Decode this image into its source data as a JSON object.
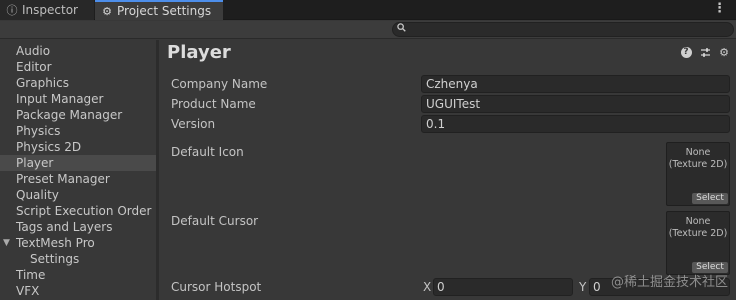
{
  "tabs": {
    "inspector_label": "Inspector",
    "project_settings_label": "Project Settings"
  },
  "menu_icon": "⋮",
  "search": {
    "placeholder": "",
    "value": ""
  },
  "sidebar": {
    "items": [
      {
        "label": "Audio"
      },
      {
        "label": "Editor"
      },
      {
        "label": "Graphics"
      },
      {
        "label": "Input Manager"
      },
      {
        "label": "Package Manager"
      },
      {
        "label": "Physics"
      },
      {
        "label": "Physics 2D"
      },
      {
        "label": "Player",
        "selected": true
      },
      {
        "label": "Preset Manager"
      },
      {
        "label": "Quality"
      },
      {
        "label": "Script Execution Order"
      },
      {
        "label": "Tags and Layers"
      },
      {
        "label": "TextMesh Pro",
        "expanded": true
      },
      {
        "label": "Settings",
        "child": true
      },
      {
        "label": "Time"
      },
      {
        "label": "VFX"
      }
    ]
  },
  "main": {
    "title": "Player",
    "company_name_label": "Company Name",
    "company_name_value": "Czhenya",
    "product_name_label": "Product Name",
    "product_name_value": "UGUITest",
    "version_label": "Version",
    "version_value": "0.1",
    "default_icon_label": "Default Icon",
    "default_cursor_label": "Default Cursor",
    "texture_none": "None",
    "texture_type": "(Texture 2D)",
    "select_label": "Select",
    "cursor_hotspot_label": "Cursor Hotspot",
    "hotspot_x_label": "X",
    "hotspot_x_value": "0",
    "hotspot_y_label": "Y",
    "hotspot_y_value": "0"
  },
  "watermark": "@稀土掘金技术社区"
}
